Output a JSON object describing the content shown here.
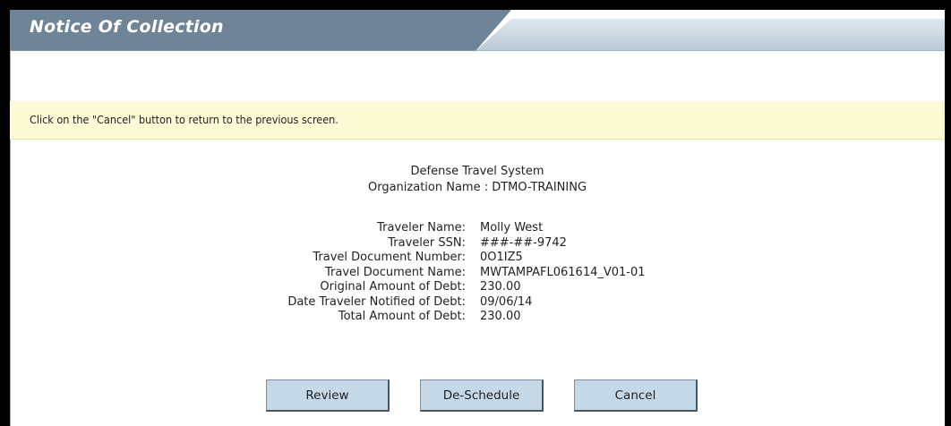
{
  "header": {
    "title": "Notice Of Collection"
  },
  "instruction": {
    "text": "Click on the \"Cancel\" button to return to the previous screen."
  },
  "summary": {
    "system_name": "Defense Travel System",
    "organization_line": "Organization Name : DTMO-TRAINING"
  },
  "details": {
    "rows": [
      {
        "label": "Traveler Name:",
        "value": "Molly West"
      },
      {
        "label": "Traveler SSN:",
        "value": "###-##-9742"
      },
      {
        "label": "Travel Document Number:",
        "value": "0O1IZ5"
      },
      {
        "label": "Travel Document Name:",
        "value": "MWTAMPAFL061614_V01-01"
      },
      {
        "label": "Original Amount of Debt:",
        "value": "230.00"
      },
      {
        "label": "Date Traveler Notified of Debt:",
        "value": "09/06/14"
      },
      {
        "label": "Total Amount of Debt:",
        "value": "230.00"
      }
    ]
  },
  "buttons": {
    "review_label": "Review",
    "deschedule_label": "De-Schedule",
    "cancel_label": "Cancel"
  },
  "colors": {
    "header_dark": "#6a8091",
    "header_light": "#c9d6e1",
    "info_bg": "#fdfbd6",
    "button_bg": "#c5d8e8"
  }
}
